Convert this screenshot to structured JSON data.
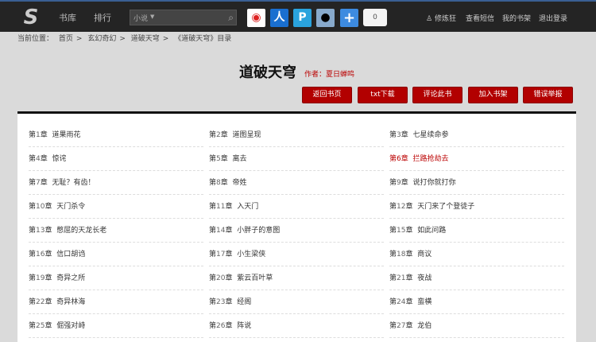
{
  "header": {
    "nav": [
      "书库",
      "排行"
    ],
    "search_category": "小说",
    "share_count": "0",
    "user_links": [
      "修炼狂",
      "查看短信",
      "我的书架",
      "退出登录"
    ]
  },
  "breadcrumb": {
    "label": "当前位置：",
    "items": [
      "首页",
      "玄幻奇幻",
      "道破天穹",
      "《道破天穹》目录"
    ],
    "separator": ">"
  },
  "book": {
    "title": "道破天穹",
    "author": "作者：夏日蝉鸣"
  },
  "buttons": [
    "返回书页",
    "txt下载",
    "评论此书",
    "加入书架",
    "错误举报"
  ],
  "chapters": [
    {
      "num": "1",
      "title": "道果雨花"
    },
    {
      "num": "2",
      "title": "道图呈现"
    },
    {
      "num": "3",
      "title": "七星续命参"
    },
    {
      "num": "4",
      "title": "惊诧"
    },
    {
      "num": "5",
      "title": "离去"
    },
    {
      "num": "6",
      "title": "拦路抢劫去",
      "highlight": true
    },
    {
      "num": "7",
      "title": "无耻？有齿！"
    },
    {
      "num": "8",
      "title": "帝姓"
    },
    {
      "num": "9",
      "title": "说打你就打你"
    },
    {
      "num": "10",
      "title": "天门杀令"
    },
    {
      "num": "11",
      "title": "入天门"
    },
    {
      "num": "12",
      "title": "天门来了个登徒子"
    },
    {
      "num": "13",
      "title": "憋屈的天龙长老"
    },
    {
      "num": "14",
      "title": "小胖子的意图"
    },
    {
      "num": "15",
      "title": "如此问路"
    },
    {
      "num": "16",
      "title": "信口胡诌"
    },
    {
      "num": "17",
      "title": "小生梁侠"
    },
    {
      "num": "18",
      "title": "商议"
    },
    {
      "num": "19",
      "title": "奇异之所"
    },
    {
      "num": "20",
      "title": "紫云百叶草"
    },
    {
      "num": "21",
      "title": "夜战"
    },
    {
      "num": "22",
      "title": "奇异林海"
    },
    {
      "num": "23",
      "title": "经阁"
    },
    {
      "num": "24",
      "title": "蛮横"
    },
    {
      "num": "25",
      "title": "倔强对峙"
    },
    {
      "num": "26",
      "title": "阵说"
    },
    {
      "num": "27",
      "title": "龙伯"
    }
  ],
  "chapter_prefix": "第",
  "chapter_suffix": "章"
}
